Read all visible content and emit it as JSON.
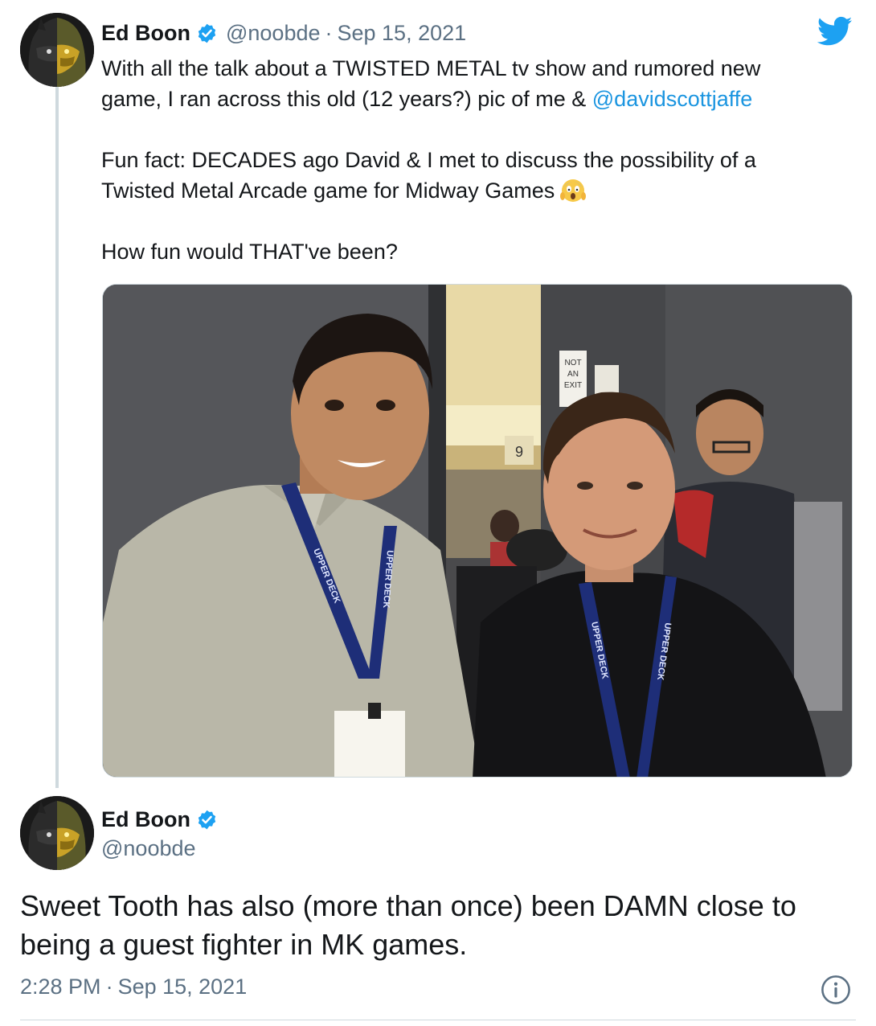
{
  "tweet": {
    "author_name": "Ed Boon",
    "handle": "@noobde",
    "separator": "·",
    "date": "Sep 15, 2021",
    "text_line1": "With all the talk about a TWISTED METAL tv show and rumored new",
    "text_line2_before": "game, I ran across this old (12 years?) pic of me & ",
    "mention": "@davidscottjaffe",
    "text_para2_line1": "Fun fact: DECADES ago David & I met to discuss the possibility of a",
    "text_para2_line2": "Twisted Metal Arcade game for Midway Games",
    "emoji": "face-screaming-in-fear",
    "text_para3": "How fun would THAT've been?",
    "photo": {
      "lanyard_text": "UPPER DECK",
      "sign_text_1": "NOT",
      "sign_text_2": "AN",
      "sign_text_3": "EXIT",
      "door_number": "9"
    }
  },
  "reply": {
    "author_name": "Ed Boon",
    "handle": "@noobde",
    "text_line1": "Sweet Tooth has also (more than once) been DAMN close to",
    "text_line2": "being a guest fighter in MK games.",
    "time": "2:28 PM",
    "separator": "·",
    "date": "Sep 15, 2021"
  },
  "icons": {
    "logo": "twitter-bird-icon",
    "verified": "verified-badge-icon",
    "info": "info-icon"
  },
  "colors": {
    "link": "#1b95e0",
    "secondary_text": "#5b7083",
    "primary_text": "#14171a",
    "verified_badge": "#1da1f2",
    "border": "#cfd9de"
  }
}
